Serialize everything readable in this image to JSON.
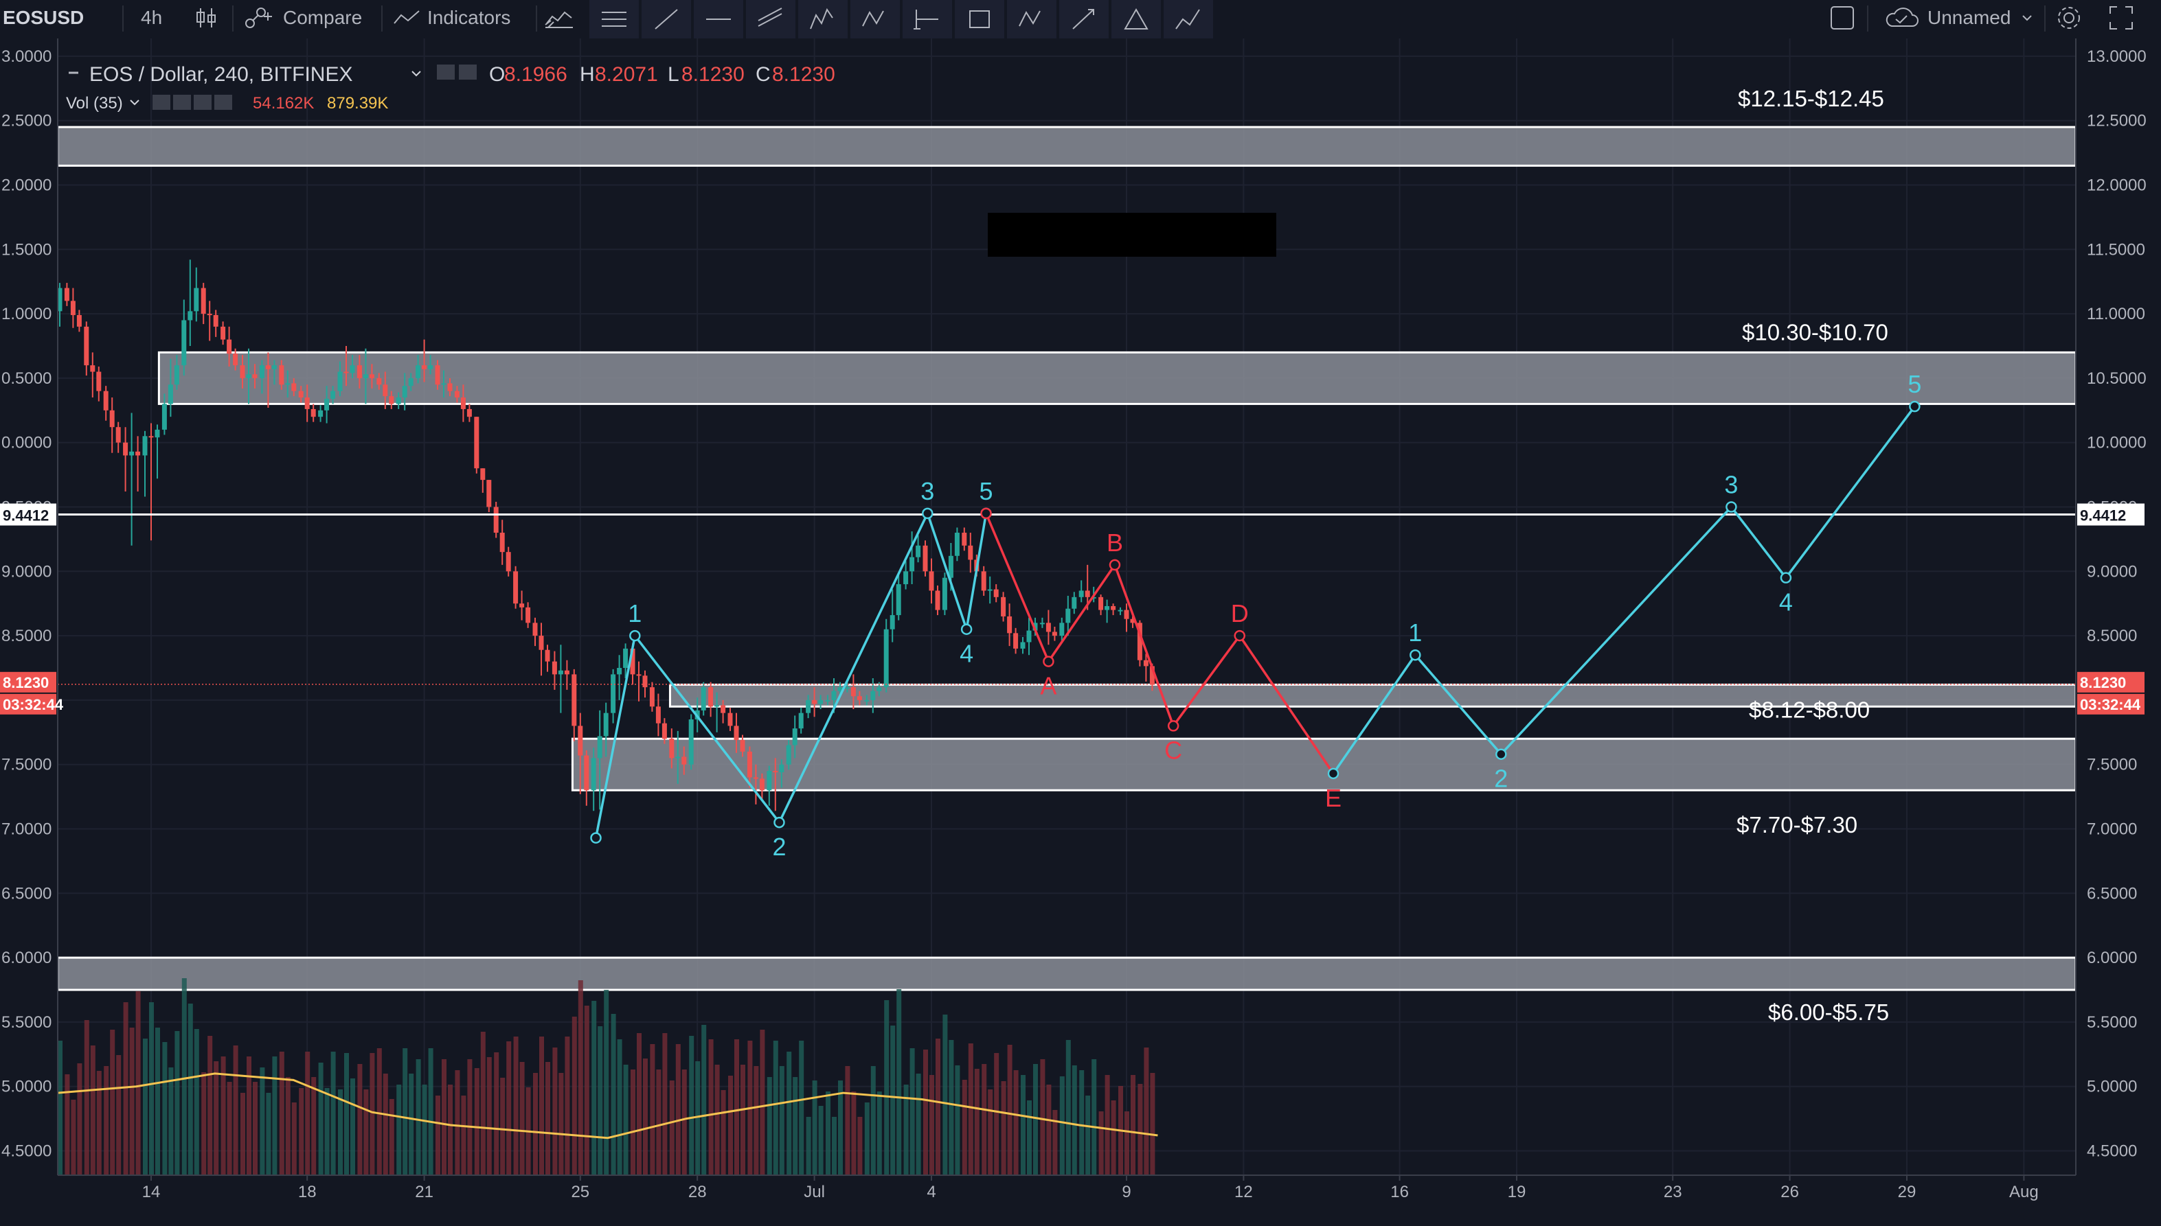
{
  "toolbar": {
    "symbol": "EOSUSD",
    "interval": "4h",
    "compare_label": "Compare",
    "indicators_label": "Indicators",
    "layout_name": "Unnamed",
    "drawing_tools": [
      "horizontal-lines-icon",
      "trend-line-icon",
      "horizontal-line-icon",
      "channel-icon",
      "elliott-impulse-icon",
      "elliott-correction-icon",
      "long-position-icon",
      "rectangle-icon",
      "abc-pattern-icon",
      "arrow-icon",
      "triangle-icon",
      "path-icon"
    ]
  },
  "legend": {
    "symbol_title": "EOS / Dollar, 240, BITFINEX",
    "o_label": "O",
    "o_value": "8.1966",
    "h_label": "H",
    "h_value": "8.2071",
    "l_label": "L",
    "l_value": "8.1230",
    "c_label": "C",
    "c_value": "8.1230",
    "vol_label": "Vol (35)",
    "vol_value": "54.162K",
    "vol_ma_value": "879.39K"
  },
  "price_tags": {
    "last_price": "8.1230",
    "countdown": "03:32:44",
    "hline_price": "9.4412"
  },
  "colors": {
    "background": "#131722",
    "up": "#26a69a",
    "down": "#ef5350",
    "wave_main": "#4dd0e1",
    "wave_corrective": "#f23645",
    "zone_fill": "#8a8d96",
    "volume_ma": "#f5c451"
  },
  "chart_data": {
    "type": "candlestick",
    "title": "EOS / Dollar, 240, BITFINEX",
    "y_axis": {
      "ticks": [
        4.5,
        5.0,
        5.5,
        6.0,
        6.5,
        7.0,
        7.5,
        8.0,
        8.5,
        9.0,
        9.5,
        10.0,
        10.5,
        11.0,
        11.5,
        12.0,
        12.5,
        13.0
      ],
      "right_labels": [
        "4.5000",
        "5.0000",
        "5.5000",
        "6.0000",
        "6.5000",
        "7.0000",
        "7.5000",
        "8.0000",
        "8.5000",
        "9.0000",
        "9.5000",
        "10.0000",
        "10.5000",
        "11.0000",
        "11.5000",
        "12.0000",
        "12.5000",
        "13.0000"
      ],
      "left_labels": [
        "4.5000",
        "5.0000",
        "5.5000",
        "6.0000",
        "6.5000",
        "7.0000",
        "7.5000",
        "8.0000",
        "8.5000",
        "9.0000",
        "9.5000",
        "0.0000",
        "0.5000",
        "1.0000",
        "1.5000",
        "2.0000",
        "2.5000",
        "3.0000"
      ]
    },
    "x_axis": {
      "ticks": [
        {
          "label": "14",
          "day": 14
        },
        {
          "label": "18",
          "day": 18
        },
        {
          "label": "21",
          "day": 21
        },
        {
          "label": "25",
          "day": 25
        },
        {
          "label": "28",
          "day": 28
        },
        {
          "label": "Jul",
          "day": 31
        },
        {
          "label": "4",
          "day": 34
        },
        {
          "label": "9",
          "day": 39
        },
        {
          "label": "12",
          "day": 42
        },
        {
          "label": "16",
          "day": 46
        },
        {
          "label": "19",
          "day": 49
        },
        {
          "label": "23",
          "day": 53
        },
        {
          "label": "26",
          "day": 56
        },
        {
          "label": "29",
          "day": 59
        },
        {
          "label": "Aug",
          "day": 62
        }
      ],
      "note": "day index counted from 1 June (Jul 1 = 31)"
    },
    "candles_daily": [
      {
        "day": 11.5,
        "o": 10.6,
        "h": 11.3,
        "l": 10.3,
        "c": 11.2
      },
      {
        "day": 12.0,
        "o": 11.2,
        "h": 11.3,
        "l": 10.8,
        "c": 10.9
      },
      {
        "day": 12.5,
        "o": 10.9,
        "h": 11.0,
        "l": 10.2,
        "c": 10.4
      },
      {
        "day": 13.0,
        "o": 10.4,
        "h": 10.5,
        "l": 9.8,
        "c": 10.0
      },
      {
        "day": 13.5,
        "o": 10.0,
        "h": 10.3,
        "l": 9.2,
        "c": 9.9
      },
      {
        "day": 14.0,
        "o": 9.9,
        "h": 10.2,
        "l": 9.1,
        "c": 10.1
      },
      {
        "day": 14.5,
        "o": 10.1,
        "h": 10.8,
        "l": 10.0,
        "c": 10.6
      },
      {
        "day": 15.0,
        "o": 10.6,
        "h": 11.6,
        "l": 10.4,
        "c": 11.2
      },
      {
        "day": 15.5,
        "o": 11.2,
        "h": 11.3,
        "l": 10.7,
        "c": 10.9
      },
      {
        "day": 16.0,
        "o": 10.9,
        "h": 11.0,
        "l": 10.5,
        "c": 10.6
      },
      {
        "day": 16.5,
        "o": 10.6,
        "h": 10.8,
        "l": 10.3,
        "c": 10.5
      },
      {
        "day": 17.0,
        "o": 10.5,
        "h": 10.7,
        "l": 10.2,
        "c": 10.6
      },
      {
        "day": 17.5,
        "o": 10.6,
        "h": 10.7,
        "l": 10.3,
        "c": 10.4
      },
      {
        "day": 18.0,
        "o": 10.4,
        "h": 10.5,
        "l": 10.1,
        "c": 10.2
      },
      {
        "day": 18.5,
        "o": 10.2,
        "h": 10.5,
        "l": 10.1,
        "c": 10.4
      },
      {
        "day": 19.0,
        "o": 10.4,
        "h": 10.8,
        "l": 10.3,
        "c": 10.6
      },
      {
        "day": 19.5,
        "o": 10.6,
        "h": 10.8,
        "l": 10.3,
        "c": 10.5
      },
      {
        "day": 20.0,
        "o": 10.5,
        "h": 10.6,
        "l": 10.2,
        "c": 10.3
      },
      {
        "day": 20.5,
        "o": 10.3,
        "h": 10.6,
        "l": 10.2,
        "c": 10.5
      },
      {
        "day": 21.0,
        "o": 10.5,
        "h": 10.8,
        "l": 10.4,
        "c": 10.6
      },
      {
        "day": 21.5,
        "o": 10.6,
        "h": 10.7,
        "l": 10.3,
        "c": 10.4
      },
      {
        "day": 22.0,
        "o": 10.4,
        "h": 10.5,
        "l": 10.1,
        "c": 10.2
      },
      {
        "day": 22.5,
        "o": 10.2,
        "h": 10.2,
        "l": 9.4,
        "c": 9.5
      },
      {
        "day": 23.0,
        "o": 9.5,
        "h": 9.6,
        "l": 8.9,
        "c": 9.0
      },
      {
        "day": 23.5,
        "o": 9.0,
        "h": 9.1,
        "l": 8.5,
        "c": 8.6
      },
      {
        "day": 24.0,
        "o": 8.6,
        "h": 8.7,
        "l": 8.1,
        "c": 8.3
      },
      {
        "day": 24.5,
        "o": 8.3,
        "h": 8.5,
        "l": 7.9,
        "c": 8.2
      },
      {
        "day": 25.0,
        "o": 8.2,
        "h": 8.3,
        "l": 7.0,
        "c": 7.3
      },
      {
        "day": 25.5,
        "o": 7.3,
        "h": 8.1,
        "l": 6.9,
        "c": 7.9
      },
      {
        "day": 26.0,
        "o": 7.9,
        "h": 8.5,
        "l": 7.7,
        "c": 8.4
      },
      {
        "day": 26.5,
        "o": 8.4,
        "h": 8.5,
        "l": 7.9,
        "c": 8.1
      },
      {
        "day": 27.0,
        "o": 8.1,
        "h": 8.2,
        "l": 7.6,
        "c": 7.7
      },
      {
        "day": 27.5,
        "o": 7.7,
        "h": 7.9,
        "l": 7.3,
        "c": 7.5
      },
      {
        "day": 28.0,
        "o": 7.5,
        "h": 8.2,
        "l": 7.4,
        "c": 8.1
      },
      {
        "day": 28.5,
        "o": 8.1,
        "h": 8.2,
        "l": 7.7,
        "c": 7.9
      },
      {
        "day": 29.0,
        "o": 7.9,
        "h": 8.0,
        "l": 7.5,
        "c": 7.6
      },
      {
        "day": 29.5,
        "o": 7.6,
        "h": 7.7,
        "l": 7.1,
        "c": 7.3
      },
      {
        "day": 30.0,
        "o": 7.3,
        "h": 7.6,
        "l": 7.0,
        "c": 7.5
      },
      {
        "day": 30.5,
        "o": 7.5,
        "h": 8.0,
        "l": 7.4,
        "c": 7.9
      },
      {
        "day": 31.0,
        "o": 7.9,
        "h": 8.1,
        "l": 7.8,
        "c": 8.0
      },
      {
        "day": 31.5,
        "o": 8.0,
        "h": 8.2,
        "l": 7.9,
        "c": 8.1
      },
      {
        "day": 32.0,
        "o": 8.1,
        "h": 8.2,
        "l": 7.9,
        "c": 8.0
      },
      {
        "day": 32.5,
        "o": 8.0,
        "h": 8.2,
        "l": 7.9,
        "c": 8.1
      },
      {
        "day": 33.0,
        "o": 8.1,
        "h": 9.1,
        "l": 8.0,
        "c": 8.9
      },
      {
        "day": 33.5,
        "o": 8.9,
        "h": 9.4,
        "l": 8.8,
        "c": 9.2
      },
      {
        "day": 34.0,
        "o": 9.2,
        "h": 9.3,
        "l": 8.6,
        "c": 8.7
      },
      {
        "day": 34.5,
        "o": 8.7,
        "h": 9.4,
        "l": 8.6,
        "c": 9.3
      },
      {
        "day": 35.0,
        "o": 9.3,
        "h": 9.4,
        "l": 8.9,
        "c": 9.0
      },
      {
        "day": 35.5,
        "o": 9.0,
        "h": 9.1,
        "l": 8.7,
        "c": 8.8
      },
      {
        "day": 36.0,
        "o": 8.8,
        "h": 8.9,
        "l": 8.3,
        "c": 8.4
      },
      {
        "day": 36.5,
        "o": 8.4,
        "h": 8.7,
        "l": 8.3,
        "c": 8.6
      },
      {
        "day": 37.0,
        "o": 8.6,
        "h": 8.7,
        "l": 8.4,
        "c": 8.5
      },
      {
        "day": 37.5,
        "o": 8.5,
        "h": 8.9,
        "l": 8.4,
        "c": 8.8
      },
      {
        "day": 38.0,
        "o": 8.8,
        "h": 9.0,
        "l": 8.7,
        "c": 8.8
      },
      {
        "day": 38.5,
        "o": 8.8,
        "h": 8.85,
        "l": 8.6,
        "c": 8.7
      },
      {
        "day": 39.0,
        "o": 8.7,
        "h": 8.75,
        "l": 8.5,
        "c": 8.6
      },
      {
        "day": 39.5,
        "o": 8.6,
        "h": 8.65,
        "l": 8.0,
        "c": 8.12
      }
    ],
    "volume_ma_profile": [
      4.95,
      5.0,
      5.1,
      5.05,
      4.8,
      4.7,
      4.65,
      4.6,
      4.75,
      4.85,
      4.95,
      4.9,
      4.8,
      4.7,
      4.62
    ],
    "zones": [
      {
        "label": "$12.15-$12.45",
        "low": 12.15,
        "high": 12.45,
        "from_day": 10.0,
        "to_day": 61.0
      },
      {
        "label": "$10.30-$10.70",
        "low": 10.3,
        "high": 10.7,
        "from_day": 14.2,
        "to_day": 61.0
      },
      {
        "label": "$8.12-$8.00",
        "low": 7.95,
        "high": 8.12,
        "from_day": 27.3,
        "to_day": 61.0
      },
      {
        "label": "$7.70-$7.30",
        "low": 7.3,
        "high": 7.7,
        "from_day": 24.8,
        "to_day": 61.0
      },
      {
        "label": "$6.00-$5.75",
        "low": 5.75,
        "high": 6.0,
        "from_day": 10.0,
        "to_day": 61.0
      }
    ],
    "horizontal_line": 9.4412,
    "last_price": 8.123,
    "waves": [
      {
        "name": "impulse-1",
        "color": "wave_main",
        "points": [
          {
            "day": 25.4,
            "value": 6.93,
            "label": ""
          },
          {
            "day": 26.4,
            "value": 8.5,
            "label": "1"
          },
          {
            "day": 30.1,
            "value": 7.05,
            "label": "2"
          },
          {
            "day": 33.9,
            "value": 9.45,
            "label": "3"
          },
          {
            "day": 34.9,
            "value": 8.55,
            "label": "4"
          },
          {
            "day": 35.4,
            "value": 9.45,
            "label": "5"
          }
        ]
      },
      {
        "name": "correction",
        "color": "wave_corrective",
        "points": [
          {
            "day": 35.4,
            "value": 9.45,
            "label": ""
          },
          {
            "day": 37.0,
            "value": 8.3,
            "label": "A"
          },
          {
            "day": 38.7,
            "value": 9.05,
            "label": "B"
          },
          {
            "day": 40.2,
            "value": 7.8,
            "label": "C"
          },
          {
            "day": 41.9,
            "value": 8.5,
            "label": "D"
          },
          {
            "day": 44.3,
            "value": 7.43,
            "label": "E"
          }
        ]
      },
      {
        "name": "impulse-2",
        "color": "wave_main",
        "points": [
          {
            "day": 44.3,
            "value": 7.43,
            "label": ""
          },
          {
            "day": 46.4,
            "value": 8.35,
            "label": "1"
          },
          {
            "day": 48.6,
            "value": 7.58,
            "label": "2"
          },
          {
            "day": 54.5,
            "value": 9.5,
            "label": "3"
          },
          {
            "day": 55.9,
            "value": 8.95,
            "label": "4"
          },
          {
            "day": 59.2,
            "value": 10.28,
            "label": "5"
          }
        ]
      }
    ]
  }
}
